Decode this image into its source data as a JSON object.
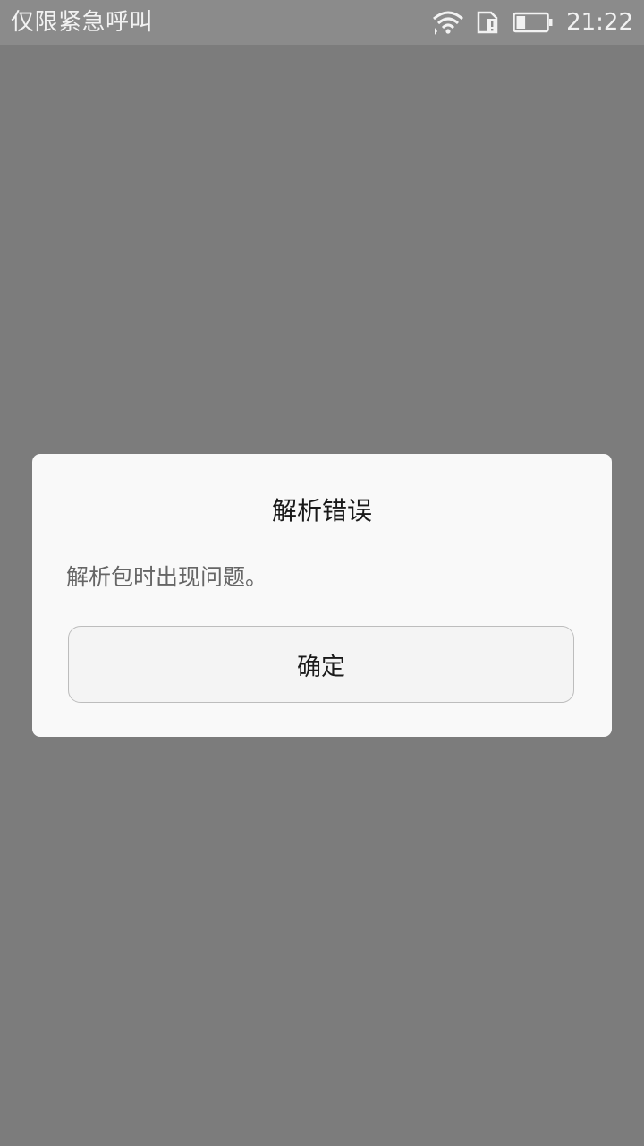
{
  "status_bar": {
    "carrier_text": "仅限紧急呼叫",
    "time": "21:22",
    "icons": [
      "wifi-icon",
      "sim-alert-icon",
      "battery-icon"
    ],
    "battery_level_fraction": 0.3
  },
  "dialog": {
    "title": "解析错误",
    "message": "解析包时出现问题。",
    "ok_label": "确定"
  },
  "colors": {
    "scrim": "#7c7c7c",
    "status_bar": "#8b8b8b",
    "dialog_bg": "#f9f9f9",
    "button_bg": "#f4f4f4",
    "button_border": "#bdbdbd"
  }
}
